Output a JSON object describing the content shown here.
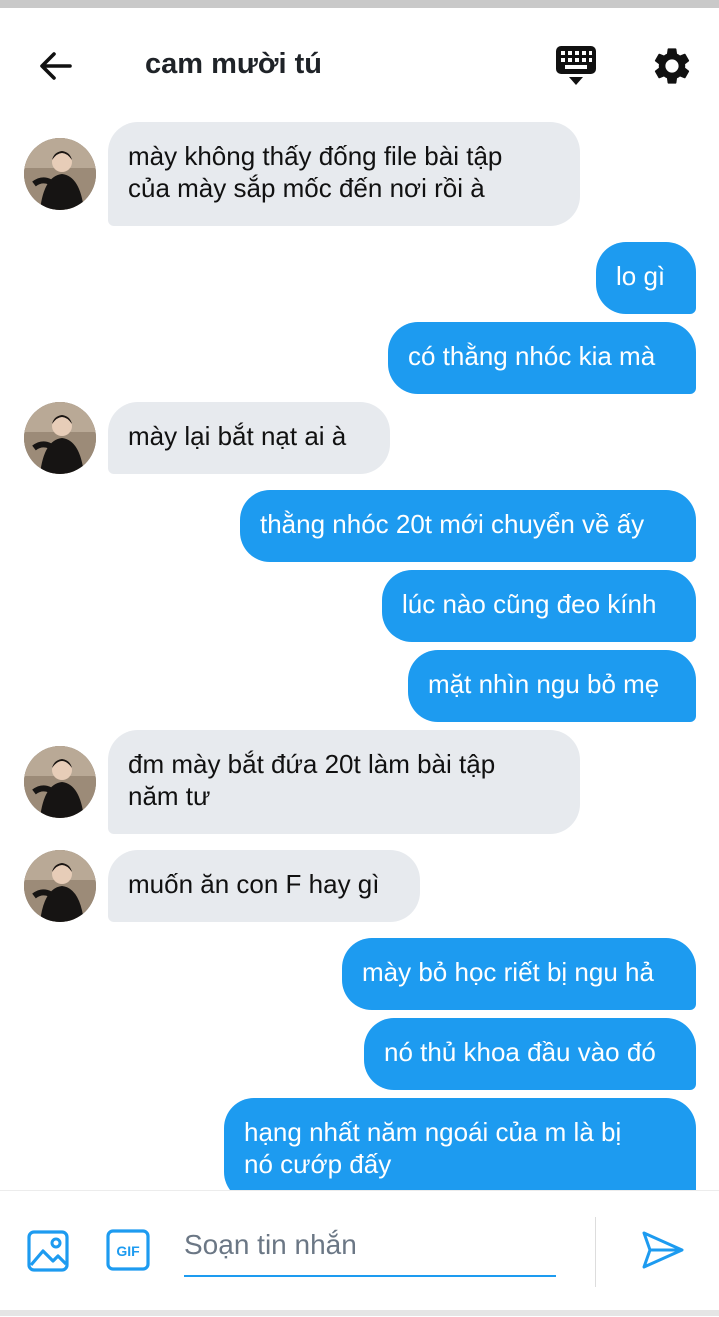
{
  "header": {
    "title": "cam mười tú"
  },
  "messages": [
    {
      "side": "in",
      "text": "mày không thấy đống file bài tập\ncủa mày sắp mốc đến nơi rồi à",
      "avatar": true
    },
    {
      "side": "out",
      "text": "lo gì"
    },
    {
      "side": "out",
      "text": "có thằng nhóc kia mà"
    },
    {
      "side": "in",
      "text": "mày lại bắt nạt ai à",
      "avatar": true
    },
    {
      "side": "out",
      "text": "thằng nhóc 20t mới chuyển về ấy"
    },
    {
      "side": "out",
      "text": "lúc nào cũng đeo kính"
    },
    {
      "side": "out",
      "text": "mặt nhìn ngu bỏ mẹ"
    },
    {
      "side": "in",
      "text": "đm mày bắt đứa 20t làm bài tập\nnăm tư",
      "avatar": true
    },
    {
      "side": "in",
      "text": "muốn ăn con F hay gì",
      "avatar": true
    },
    {
      "side": "out",
      "text": "mày bỏ học riết bị ngu hả"
    },
    {
      "side": "out",
      "text": "nó thủ khoa đầu vào đó"
    },
    {
      "side": "out",
      "text": "hạng nhất năm ngoái của m là bị\nnó cướp đấy"
    }
  ],
  "composer": {
    "placeholder": "Soạn tin nhắn",
    "value": ""
  },
  "icons": {
    "back": "arrow-left-icon",
    "keyboard": "keyboard-icon",
    "settings": "gear-icon",
    "image": "image-icon",
    "gif": "gif-icon",
    "send": "send-icon"
  },
  "colors": {
    "accent": "#1d9bf0",
    "incoming_bubble": "#e7eaee",
    "text": "#1f2328"
  }
}
